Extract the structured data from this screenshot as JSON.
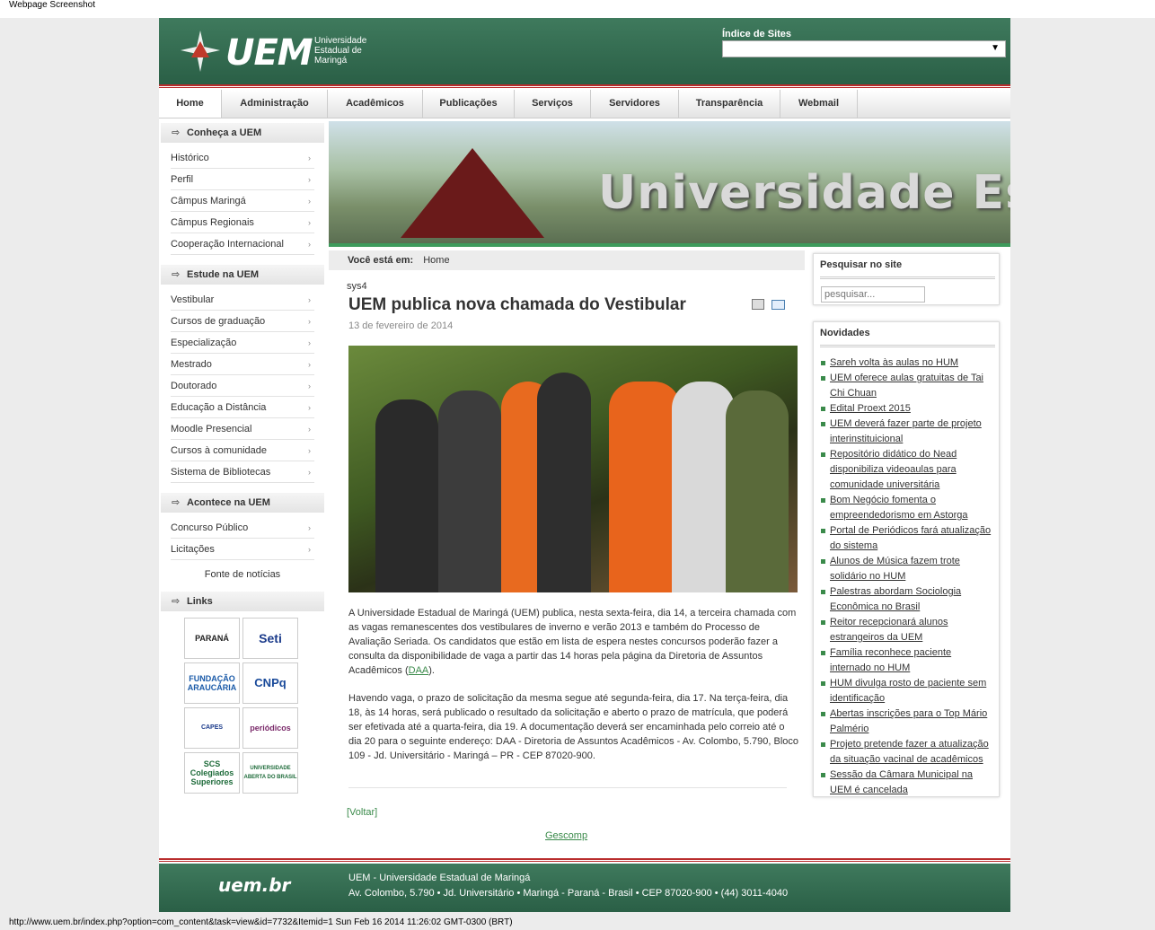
{
  "screenshot_label": "Webpage Screenshot",
  "header": {
    "logo_text": "UEM",
    "logo_subtitle": "Universidade Estadual de Maringá",
    "index_label": "Índice de Sites",
    "index_value": ""
  },
  "nav": [
    "Home",
    "Administração",
    "Acadêmicos",
    "Publicações",
    "Serviços",
    "Servidores",
    "Transparência",
    "Webmail"
  ],
  "sidebar": {
    "sections": [
      {
        "title": "Conheça a UEM",
        "items": [
          "Histórico",
          "Perfil",
          "Câmpus Maringá",
          "Câmpus Regionais",
          "Cooperação Internacional"
        ]
      },
      {
        "title": "Estude na UEM",
        "items": [
          "Vestibular",
          "Cursos de graduação",
          "Especialização",
          "Mestrado",
          "Doutorado",
          "Educação a Distância",
          "Moodle Presencial",
          "Cursos à comunidade",
          "Sistema de Bibliotecas"
        ]
      },
      {
        "title": "Acontece na UEM",
        "items": [
          "Concurso Público",
          "Licitações"
        ]
      },
      {
        "title": "Links",
        "items": []
      }
    ],
    "fonte": "Fonte de notícias",
    "links": [
      "PARANÁ",
      "Seti",
      "FUNDAÇÃO ARAUCÁRIA",
      "CNPq",
      "CAPES",
      "periódicos",
      "SCS Colegiados Superiores",
      "UNIVERSIDADE ABERTA DO BRASIL"
    ]
  },
  "banner": {
    "text": "Universidade Estadual de Maringá"
  },
  "breadcrumb": {
    "label": "Você está em:",
    "value": "Home"
  },
  "article": {
    "author": "sys4",
    "title": "UEM publica nova chamada do Vestibular",
    "date": "13 de fevereiro de 2014",
    "p1_before": "A Universidade Estadual de Maringá (UEM) publica, nesta sexta-feira, dia 14, a terceira chamada com as vagas remanescentes dos vestibulares de inverno e verão 2013 e também do Processo de Avaliação Seriada. Os candidatos que estão em lista de espera nestes concursos poderão fazer a consulta da disponibilidade de vaga a partir das 14 horas pela página da Diretoria de Assuntos Acadêmicos (",
    "p1_link": "DAA",
    "p1_after": ").",
    "p2": "Havendo vaga, o prazo de solicitação da mesma segue até segunda-feira, dia 17. Na terça-feira, dia 18, às 14 horas, será publicado o resultado da solicitação e aberto o prazo de matrícula, que poderá ser efetivada até a quarta-feira, dia 19. A documentação deverá ser encaminhada pelo correio até o dia 20 para o seguinte endereço: DAA - Diretoria de Assuntos Acadêmicos - Av. Colombo, 5.790, Bloco 109 - Jd. Universitário - Maringá – PR - CEP 87020-900.",
    "voltar": "[Voltar]",
    "gescomp": "Gescomp"
  },
  "search_box": {
    "title": "Pesquisar no site",
    "placeholder": "pesquisar..."
  },
  "news_box": {
    "title": "Novidades",
    "items": [
      {
        "lines": [
          "Sareh volta às aulas no HUM"
        ]
      },
      {
        "lines": [
          "UEM oferece aulas gratuitas de Tai",
          "Chi Chuan"
        ]
      },
      {
        "lines": [
          "Edital Proext 2015"
        ]
      },
      {
        "lines": [
          "UEM deverá fazer parte de projeto",
          "interinstituicional"
        ]
      },
      {
        "lines": [
          "Repositório didático do Nead",
          "disponibiliza videoaulas para",
          "comunidade universitária"
        ]
      },
      {
        "lines": [
          "Bom Negócio fomenta o",
          "empreendedorismo em Astorga"
        ]
      },
      {
        "lines": [
          "Portal de Periódicos fará atualização",
          "do sistema"
        ]
      },
      {
        "lines": [
          "Alunos de Música fazem trote",
          "solidário no HUM"
        ]
      },
      {
        "lines": [
          "Palestras abordam Sociologia",
          "Econômica no Brasil"
        ]
      },
      {
        "lines": [
          "Reitor recepcionará alunos",
          "estrangeiros da UEM"
        ]
      },
      {
        "lines": [
          "Família reconhece paciente",
          "internado no HUM"
        ]
      },
      {
        "lines": [
          "HUM divulga rosto de paciente sem",
          "identificação"
        ]
      },
      {
        "lines": [
          "Abertas inscrições para o Top Mário",
          "Palmério"
        ]
      },
      {
        "lines": [
          "Projeto pretende fazer a atualização",
          "da situação vacinal de acadêmicos"
        ]
      },
      {
        "lines": [
          "Sessão da Câmara Municipal na",
          "UEM é cancelada"
        ]
      }
    ]
  },
  "footer": {
    "brand": "uem.br",
    "line1": "UEM - Universidade Estadual de Maringá",
    "line2": "Av. Colombo, 5.790 • Jd. Universitário • Maringá - Paraná - Brasil • CEP 87020-900 • (44) 3011-4040"
  },
  "status_bar": "http://www.uem.br/index.php?option=com_content&task=view&id=7732&Itemid=1 Sun Feb 16 2014 11:26:02 GMT-0300 (BRT)",
  "colors": {
    "brand_green": "#2f6b4f",
    "accent_red": "#b92d2d",
    "link_green": "#3a8a4a"
  }
}
